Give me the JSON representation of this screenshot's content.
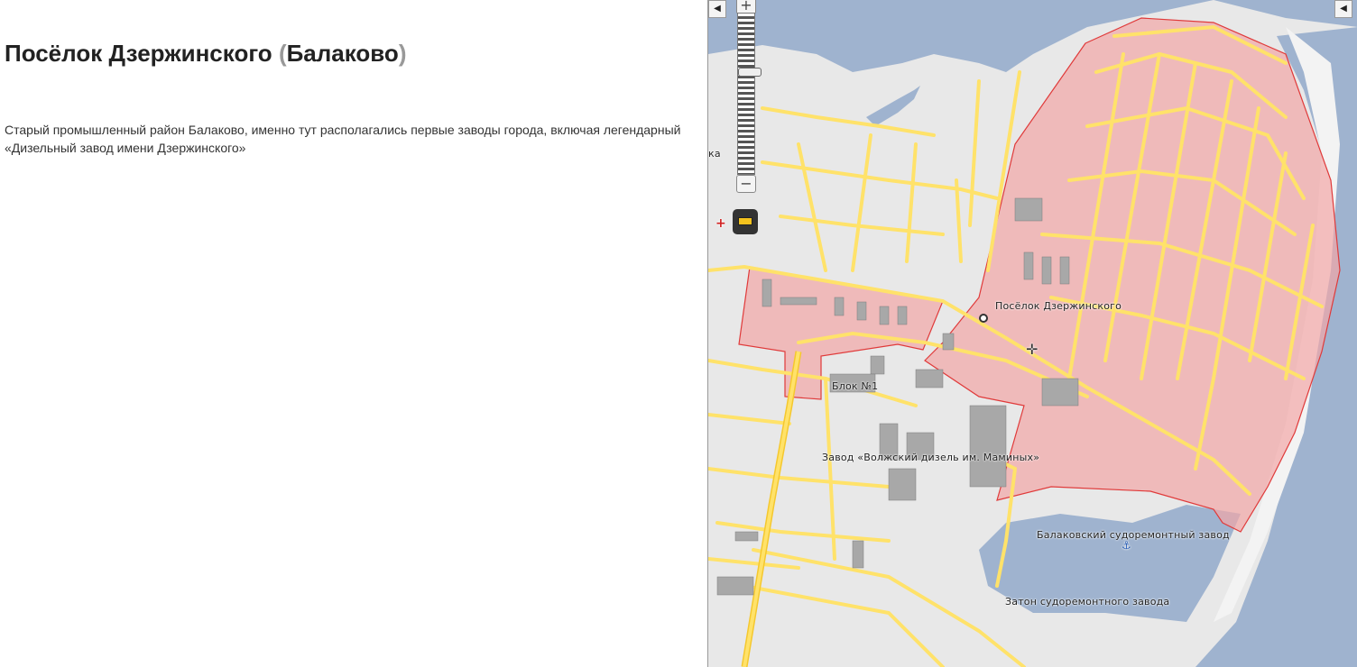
{
  "page": {
    "title_main": "Посёлок Дзержинского",
    "title_paren_open": "(",
    "title_city": "Балаково",
    "title_paren_close": ")",
    "description": "Старый промышленный район Балаково, именно тут располагались первые заводы города, включая легендарный «Дизельный завод имени Дзержинского»"
  },
  "map": {
    "labels": {
      "district": "Посёлок Дзержинского",
      "block1": "Блок №1",
      "plant": "Завод «Волжский дизель им. Маминых»",
      "shipyard": "Балаковский судоремонтный завод",
      "backwater": "Затон судоремонтного завода",
      "edge": "ка"
    },
    "controls": {
      "zoom_in": "+",
      "zoom_out": "−",
      "collapse_left": "◀",
      "collapse_right": "◀"
    },
    "colors": {
      "water": "#9fb3cf",
      "land": "#e6e6e6",
      "road": "#ffe26a",
      "highlight_fill": "#f2a6a6",
      "highlight_stroke": "#e03a3a",
      "building": "#aaaaaa"
    }
  }
}
